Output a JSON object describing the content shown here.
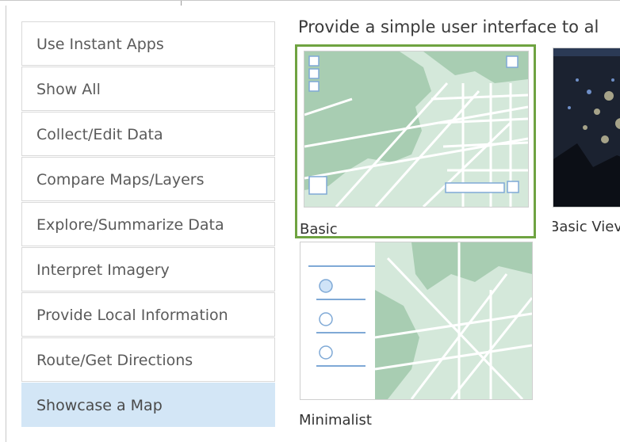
{
  "sidebar": {
    "items": [
      {
        "label": "Use Instant Apps"
      },
      {
        "label": "Show All"
      },
      {
        "label": "Collect/Edit Data"
      },
      {
        "label": "Compare Maps/Layers"
      },
      {
        "label": "Explore/Summarize Data"
      },
      {
        "label": "Interpret Imagery"
      },
      {
        "label": "Provide Local Information"
      },
      {
        "label": "Route/Get Directions"
      },
      {
        "label": "Showcase a Map",
        "selected": true
      }
    ]
  },
  "main": {
    "description": "Provide a simple user interface to al",
    "cards": [
      {
        "label": "Basic",
        "selected": true
      },
      {
        "label": "Basic Viev"
      },
      {
        "label": "Minimalist"
      }
    ]
  },
  "colors": {
    "selected_border": "#6fa341",
    "selected_sidebar_bg": "#d3e6f6",
    "map_land": "#a8cdb2",
    "map_bg": "#d4e8da"
  }
}
